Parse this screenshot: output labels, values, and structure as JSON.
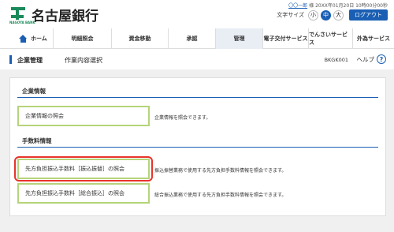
{
  "header": {
    "bank_name": "名古屋銀行",
    "logo_sub": "NAGOYA BANK",
    "user_name": "〇〇一郎",
    "user_suffix": "様",
    "login_time": "20XX年01月20日 10時00分00秒",
    "font_size_label": "文字サイズ",
    "font_small": "小",
    "font_medium": "中",
    "font_large": "大",
    "logout": "ログアウト"
  },
  "nav": {
    "items": [
      {
        "label": "ホーム"
      },
      {
        "label": "明細照会"
      },
      {
        "label": "資金移動"
      },
      {
        "label": "承認"
      },
      {
        "label": "管理"
      },
      {
        "label": "電子交付サービス"
      },
      {
        "label": "でんさいサービス"
      },
      {
        "label": "外為サービス"
      }
    ],
    "active": "管理"
  },
  "title": {
    "main": "企業管理",
    "sub": "作業内容選択",
    "screen_id": "BKGK001",
    "help": "ヘルプ"
  },
  "sections": [
    {
      "heading": "企業情報",
      "items": [
        {
          "label": "企業情報の照会",
          "description": "企業情報を照会できます。"
        }
      ]
    },
    {
      "heading": "手数料情報",
      "items": [
        {
          "label": "先方負担振込手数料［振込振替］の照会",
          "description": "振込振替業務で使用する先方負担手数料情報を照会できます。"
        },
        {
          "label": "先方負担振込手数料［総合振込］の照会",
          "description": "総合振込業務で使用する先方負担手数料情報を照会できます。"
        }
      ]
    }
  ],
  "colors": {
    "accent": "#1a5fb4",
    "button_border": "#b5d47a",
    "highlight": "#e8342c",
    "logo": "#1a8a5a"
  }
}
